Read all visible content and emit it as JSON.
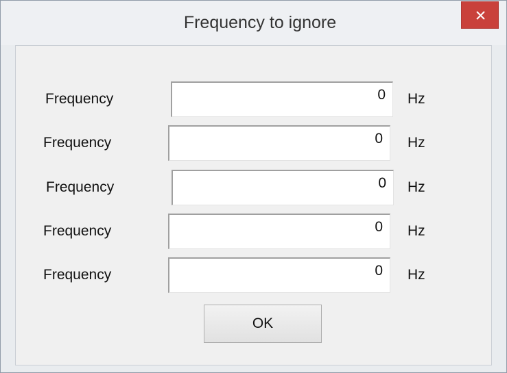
{
  "window": {
    "title": "Frequency to ignore",
    "close_glyph": "×"
  },
  "fields": [
    {
      "label": "Frequency",
      "value": "0",
      "unit": "Hz"
    },
    {
      "label": "Frequency",
      "value": "0",
      "unit": "Hz"
    },
    {
      "label": "Frequency",
      "value": "0",
      "unit": "Hz"
    },
    {
      "label": "Frequency",
      "value": "0",
      "unit": "Hz"
    },
    {
      "label": "Frequency",
      "value": "0",
      "unit": "Hz"
    }
  ],
  "buttons": {
    "ok_label": "OK"
  },
  "colors": {
    "close_button": "#c9413b",
    "titlebar": "#eef0f3",
    "client_area": "#f0f0f0"
  },
  "icons": {
    "close": "close-icon"
  }
}
